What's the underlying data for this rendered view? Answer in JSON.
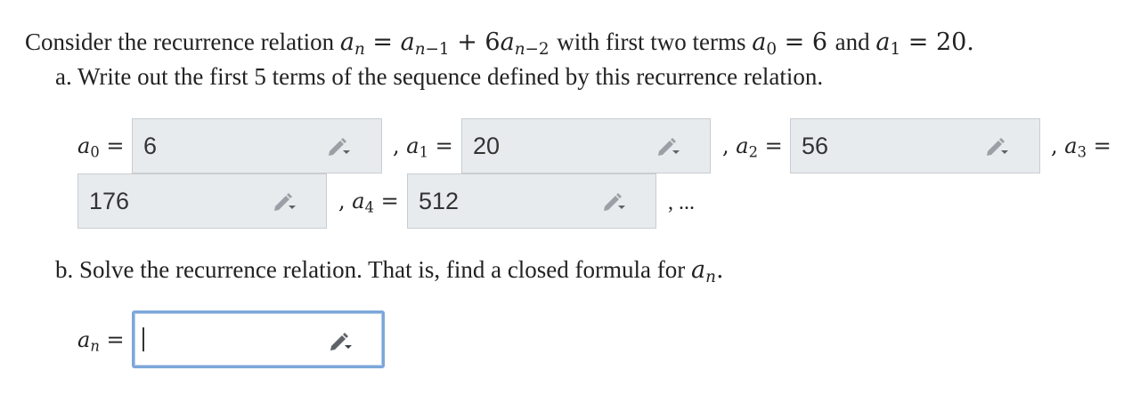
{
  "question": {
    "intro": "Consider the recurrence relation",
    "recurrence": {
      "lhs": "a",
      "lhs_sub": "n",
      "eq": "=",
      "term1": "a",
      "term1_sub": "n−1",
      "plus": "+",
      "coef": "6",
      "term2": "a",
      "term2_sub": "n−2"
    },
    "with_text": "with first two terms",
    "init0": {
      "var": "a",
      "sub": "0",
      "eq": "=",
      "val": "6"
    },
    "and_text": "and",
    "init1": {
      "var": "a",
      "sub": "1",
      "eq": "=",
      "val": "20"
    },
    "end": "."
  },
  "part_a": {
    "prompt": "a. Write out the first 5 terms of the sequence defined by this recurrence relation.",
    "terms": [
      {
        "var": "a",
        "sub": "0",
        "eq": "=",
        "value": "6"
      },
      {
        "var": "a",
        "sub": "1",
        "eq": "=",
        "value": "20"
      },
      {
        "var": "a",
        "sub": "2",
        "eq": "=",
        "value": "56"
      },
      {
        "var": "a",
        "sub": "3",
        "eq": "=",
        "value": "176"
      },
      {
        "var": "a",
        "sub": "4",
        "eq": "=",
        "value": "512"
      }
    ],
    "comma": ",",
    "ellipsis": ", ..."
  },
  "part_b": {
    "prompt_text": "b. Solve the recurrence relation. That is, find a closed formula for",
    "prompt_var": "a",
    "prompt_sub": "n",
    "prompt_end": ".",
    "answer": {
      "var": "a",
      "sub": "n",
      "eq": "=",
      "value": ""
    }
  },
  "icons": {
    "edit": "pencil-dropdown-icon"
  },
  "colors": {
    "field_bg": "#e8ebee",
    "field_border": "#c9cdd1",
    "active_border": "#7da7d9"
  }
}
